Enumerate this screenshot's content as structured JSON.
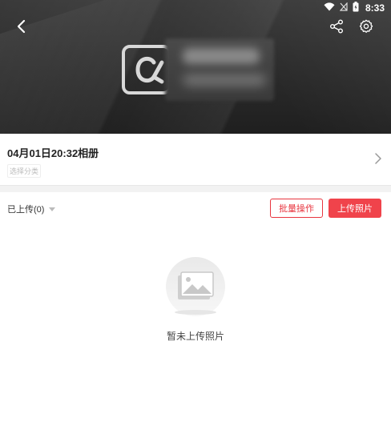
{
  "status_bar": {
    "time": "8:33",
    "icons": [
      "wifi-icon",
      "signal-off-icon",
      "battery-icon"
    ]
  },
  "header": {
    "back_icon": "chevron-left-icon",
    "share_icon": "share-icon",
    "settings_icon": "gear-icon",
    "cover_logo_icon": "album-logo-icon"
  },
  "album": {
    "title": "04月01日20:32相册",
    "category_placeholder": "选择分类",
    "chevron_icon": "chevron-right-icon"
  },
  "toolbar": {
    "uploaded_filter": "已上传(0)",
    "batch_button": "批量操作",
    "upload_button": "上传照片"
  },
  "empty_state": {
    "icon": "empty-photo-icon",
    "text": "暂未上传照片"
  },
  "colors": {
    "accent": "#f0434b",
    "accent_border": "#e8353f",
    "cover_dark": "#2b2b2b"
  }
}
